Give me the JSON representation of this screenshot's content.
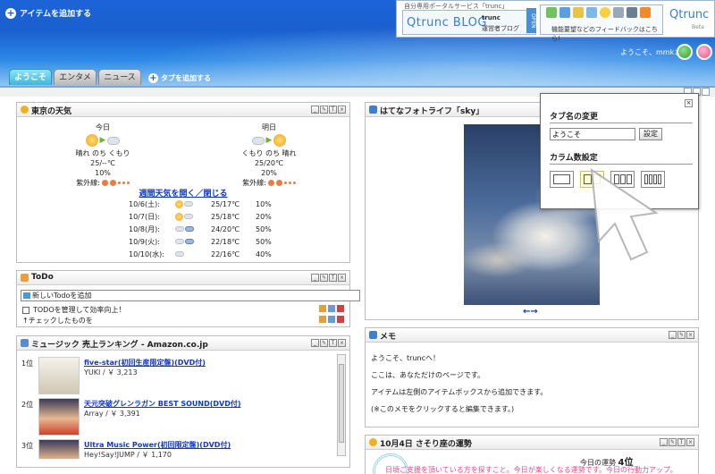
{
  "header": {
    "add_item": "アイテムを追加する",
    "banner_caption": "自分専用ポータルサービス「trunc」",
    "blog_logo": "Qtrunc BLOG",
    "blog_name": "trunc",
    "blog_sub": "運営者ブログ",
    "open_tag": "OPEN",
    "feedback": "機能要望などのフィードバックはこちら!",
    "logo": "Qtrunc",
    "logo_beta": "Beta",
    "greeting": "ようこそ、mmkさん"
  },
  "tabs": [
    {
      "label": "ようこそ",
      "active": true
    },
    {
      "label": "エンタメ",
      "active": false
    },
    {
      "label": "ニュース",
      "active": false
    }
  ],
  "add_tab": "タブを追加する",
  "weather": {
    "title": "東京の天気",
    "today": {
      "day": "今日",
      "desc": "晴れ のち くもり",
      "temp": "25/--℃",
      "precip": "10%"
    },
    "tomorrow": {
      "day": "明日",
      "desc": "くもり のち 晴れ",
      "temp": "25/20℃",
      "precip": "20%"
    },
    "uv_label": "紫外線:",
    "weekly_link": "週間天気を開く／閉じる",
    "weekly": [
      {
        "date": "10/6(土):",
        "temp": "25/17℃",
        "precip": "10%",
        "icon": "sun-cloud"
      },
      {
        "date": "10/7(日):",
        "temp": "25/18℃",
        "precip": "20%",
        "icon": "sun-cloud"
      },
      {
        "date": "10/8(月):",
        "temp": "24/20℃",
        "precip": "50%",
        "icon": "cloud-rain"
      },
      {
        "date": "10/9(火):",
        "temp": "22/18℃",
        "precip": "50%",
        "icon": "cloud-rain"
      },
      {
        "date": "10/10(水):",
        "temp": "22/16℃",
        "precip": "40%",
        "icon": "cloud"
      }
    ]
  },
  "todo": {
    "title": "ToDo",
    "input_placeholder": "新しいTodoを追加",
    "items": [
      "TODOを管理して効率向上！",
      "↑チェックしたものを"
    ]
  },
  "music": {
    "title": "ミュージック 売上ランキング - Amazon.co.jp",
    "items": [
      {
        "rank": "1位",
        "title": "five-star(初回生産限定盤)(DVD付)",
        "artist": "YUKI / ￥ 3,213"
      },
      {
        "rank": "2位",
        "title": "天元突破グレンラガン BEST SOUND(DVD付)",
        "artist": "Array / ￥ 3,391"
      },
      {
        "rank": "3位",
        "title": "Ultra Music Power(初回限定盤)(DVD付)",
        "artist": "Hey!Say!JUMP / ￥ 1,170"
      }
    ]
  },
  "photo": {
    "title": "はてなフォトライフ「sky」",
    "nav": "←→"
  },
  "memo": {
    "title": "メモ",
    "lines": [
      "ようこそ、truncへ！",
      "ここは、あなただけのページです。",
      "アイテムは左側のアイテムボックスから追加できます。",
      "(※このメモをクリックすると編集できます。)"
    ]
  },
  "fortune": {
    "title": "10月4日 さそり座の運勢",
    "rank_label": "今日の運勢",
    "rank": "4位",
    "text": "日頃ご支援を頂いている方を探すこと。今日が楽しくなる運勢です。今日の行動力アップ。"
  },
  "popup": {
    "tab_name_heading": "タブ名の変更",
    "tab_name_value": "ようこそ",
    "set_button": "設定",
    "column_heading": "カラム数設定",
    "column_options": [
      1,
      2,
      3,
      4
    ],
    "selected_columns": 2
  },
  "colors": {
    "header_blue": "#1a5fcf",
    "link_blue": "#1337c9",
    "tab_active": "#3fb7d8",
    "fortune_pink": "#e04a8a"
  }
}
